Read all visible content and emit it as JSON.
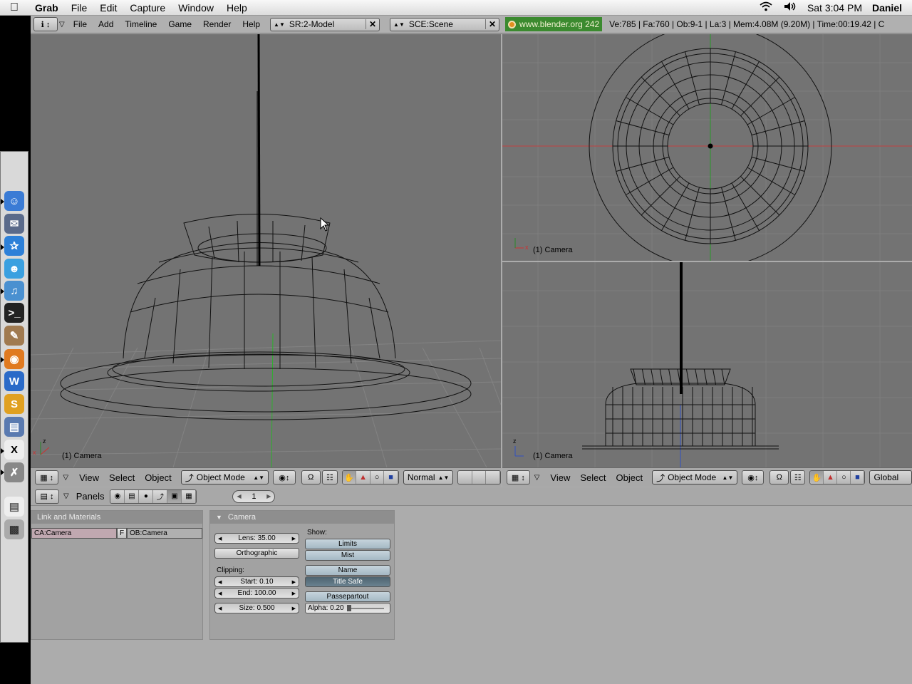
{
  "mac_menubar": {
    "app_name": "Grab",
    "menus": [
      "File",
      "Edit",
      "Capture",
      "Window",
      "Help"
    ],
    "clock": "Sat 3:04 PM",
    "user": "Daniel"
  },
  "top_header": {
    "menus": [
      "File",
      "Add",
      "Timeline",
      "Game",
      "Render",
      "Help"
    ],
    "screen": "SR:2-Model",
    "scene": "SCE:Scene",
    "website": "www.blender.org 242",
    "stats": "Ve:785 | Fa:760 | Ob:9-1 | La:3  | Mem:4.08M (9.20M)  | Time:00:19.42 | C"
  },
  "viewport_left": {
    "label": "(1) Camera",
    "menus": [
      "View",
      "Select",
      "Object"
    ],
    "mode": "Object Mode",
    "draw_type": "Normal"
  },
  "viewport_top_right": {
    "label": "(1) Camera"
  },
  "viewport_bottom_right": {
    "label": "(1) Camera",
    "menus": [
      "View",
      "Select",
      "Object"
    ],
    "mode": "Object Mode",
    "orientation": "Global"
  },
  "buttons_window": {
    "panels_label": "Panels",
    "frame": "1",
    "link_panel": {
      "title": "Link and Materials",
      "ca_field": "CA:Camera",
      "f_label": "F",
      "ob_field": "OB:Camera"
    },
    "camera_panel": {
      "title": "Camera",
      "lens": "Lens: 35.00",
      "orthographic": "Orthographic",
      "clipping_label": "Clipping:",
      "start": "Start: 0.10",
      "end": "End: 100.00",
      "size": "Size: 0.500",
      "show_label": "Show:",
      "limits": "Limits",
      "mist": "Mist",
      "name": "Name",
      "title_safe": "Title Safe",
      "passepartout": "Passepartout",
      "alpha": "Alpha: 0.20"
    }
  },
  "colors": {
    "viewport_bg": "#737373",
    "ui_bg": "#acacac",
    "web_green": "#3b8a2f"
  }
}
